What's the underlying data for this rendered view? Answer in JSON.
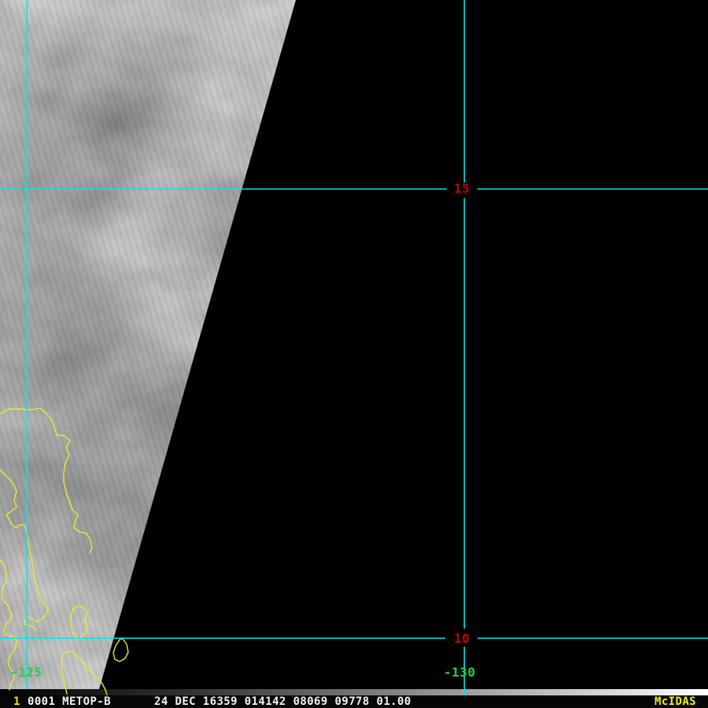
{
  "display": {
    "type": "satellite-image-frame",
    "background_color": "#000000"
  },
  "graticule": {
    "line_color": "#00e9e9",
    "latitude_labels": [
      {
        "value": "15",
        "color": "#c80000"
      },
      {
        "value": "10",
        "color": "#c80000"
      }
    ],
    "longitude_labels": [
      {
        "value": "-125",
        "color": "#1fd348"
      },
      {
        "value": "-130",
        "color": "#1fd348"
      }
    ]
  },
  "map_overlay": {
    "coastline_color": "#e9e92e"
  },
  "gray_scale_bar": {
    "start_color": "#000000",
    "end_color": "#ffffff"
  },
  "status_bar": {
    "frame_number": "1",
    "image_label": "0001 METOP-B",
    "image_time_info": "24 DEC 16359 014142 08069 09778 01.00",
    "brand": "McIDAS",
    "text_color": "#f0f0f0",
    "highlight_color": "#f0f000"
  }
}
